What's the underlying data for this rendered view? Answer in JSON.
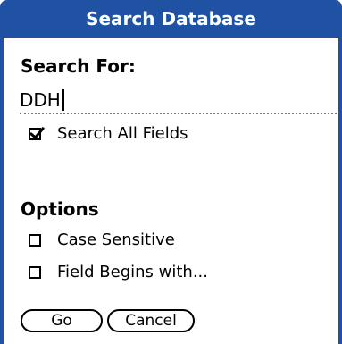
{
  "dialog": {
    "title": "Search Database"
  },
  "search": {
    "label": "Search For:",
    "value": "DDH"
  },
  "search_all_fields": {
    "label": "Search All Fields",
    "checked": true
  },
  "options": {
    "heading": "Options",
    "case_sensitive": {
      "label": "Case Sensitive",
      "checked": false
    },
    "field_begins_with": {
      "label": "Field Begins with...",
      "checked": false
    }
  },
  "buttons": {
    "go": "Go",
    "cancel": "Cancel"
  },
  "colors": {
    "title_bar": "#1f52a3",
    "title_text": "#ffffff"
  }
}
